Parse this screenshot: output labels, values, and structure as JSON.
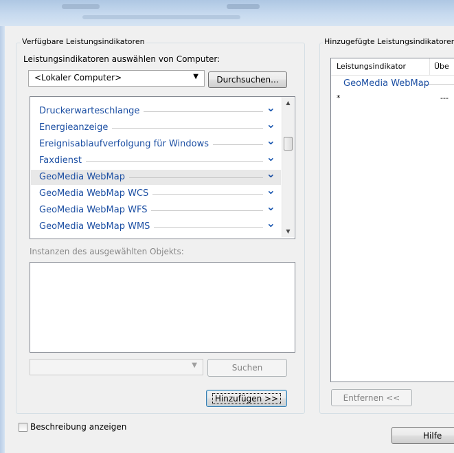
{
  "left_panel": {
    "group_title": "Verfügbare Leistungsindikatoren",
    "select_label": "Leistungsindikatoren auswählen von Computer:",
    "computer_value": "<Lokaler Computer>",
    "browse_label": "Durchsuchen...",
    "counters": [
      {
        "label": "Druckerwarteschlange",
        "selected": false
      },
      {
        "label": "Energieanzeige",
        "selected": false
      },
      {
        "label": "Ereignisablaufverfolgung für Windows",
        "selected": false
      },
      {
        "label": "Faxdienst",
        "selected": false
      },
      {
        "label": "GeoMedia WebMap",
        "selected": true
      },
      {
        "label": "GeoMedia WebMap WCS",
        "selected": false
      },
      {
        "label": "GeoMedia WebMap WFS",
        "selected": false
      },
      {
        "label": "GeoMedia WebMap WMS",
        "selected": false
      }
    ],
    "instances_label": "Instanzen des ausgewählten Objekts:",
    "search_value": "",
    "search_button": "Suchen",
    "add_button": "Hinzufügen >>"
  },
  "right_panel": {
    "group_title": "Hinzugefügte Leistungsindikatoren",
    "columns": [
      "Leistungsindikator",
      "Übe"
    ],
    "rows": [
      {
        "counter": "GeoMedia WebMap",
        "col2": "",
        "is_group": true
      },
      {
        "counter": "*",
        "col2": "---",
        "is_group": false
      }
    ],
    "remove_button": "Entfernen <<"
  },
  "footer": {
    "show_description_label": "Beschreibung anzeigen",
    "show_description_checked": false,
    "help_button": "Hilfe"
  },
  "colors": {
    "counter_text": "#1c4fa3",
    "selected_row_bg": "#e8e8e8",
    "dialog_bg": "#f0f0f0"
  }
}
